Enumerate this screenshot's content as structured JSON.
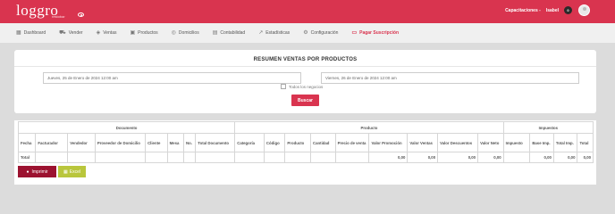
{
  "header": {
    "logo": "loggro",
    "logo_sub": "restobar",
    "user_label": "Capacitaciones -",
    "user_name": "Isabel",
    "notification_count": "0"
  },
  "nav": {
    "items": [
      {
        "label": "Dashboard",
        "icon": "grid-icon"
      },
      {
        "label": "Vender",
        "icon": "cart-icon"
      },
      {
        "label": "Ventas",
        "icon": "tag-icon"
      },
      {
        "label": "Productos",
        "icon": "box-icon"
      },
      {
        "label": "Domicilios",
        "icon": "bike-icon"
      },
      {
        "label": "Contabilidad",
        "icon": "ledger-icon"
      },
      {
        "label": "Estadísticas",
        "icon": "trend-icon"
      },
      {
        "label": "Configuración",
        "icon": "gear-icon"
      },
      {
        "label": "Pagar Suscripción",
        "icon": "card-icon"
      }
    ]
  },
  "filter": {
    "title": "RESUMEN VENTAS POR PRODUCTOS",
    "start_date": "Jueves, 25 de Enero de 2024 12:00 am",
    "end_date": "Viernes, 26 de Enero de 2024 12:00 am",
    "all_businesses_label": "Todos los negocios",
    "search_button": "Buscar"
  },
  "table": {
    "groups": {
      "documento": "Documento",
      "producto": "Producto",
      "impuestos": "Impuestos"
    },
    "columns": [
      "Fecha",
      "Facturador",
      "Vendedor",
      "Proveedor de Domicilio",
      "Cliente",
      "Mesa",
      "No.",
      "Total Documento",
      "Categoría",
      "Código",
      "Producto",
      "Cantidad",
      "Precio de venta",
      "Valor Promoción",
      "Valor Ventas",
      "Valor Descuentos",
      "Valor Neto",
      "Impuesto",
      "Base Imp.",
      "Total Imp.",
      "Total"
    ],
    "total_label": "Total",
    "total_values": {
      "valor_promocion": "0,00",
      "valor_ventas": "0,00",
      "valor_descuentos": "0,00",
      "valor_neto": "0,00",
      "base_imp": "0,00",
      "total_imp": "0,00",
      "total": "0,00"
    }
  },
  "actions": {
    "print": "Imprimir",
    "excel": "Excel"
  },
  "colors": {
    "primary": "#d9344f",
    "print_button": "#9c1230",
    "excel_button": "#b9c63c"
  }
}
